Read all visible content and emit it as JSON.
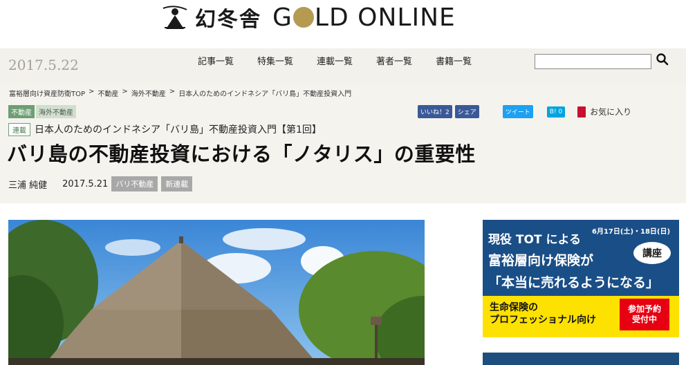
{
  "site": {
    "logo_jp": "幻冬舎",
    "logo_en_left": "G",
    "logo_en_right": "LD ONLINE"
  },
  "nav": {
    "date": "2017.5.22",
    "links": [
      "記事一覧",
      "特集一覧",
      "連載一覧",
      "著者一覧",
      "書籍一覧"
    ],
    "search_placeholder": ""
  },
  "breadcrumb": [
    "富裕層向け資産防衛TOP",
    "不動産",
    "海外不動産",
    "日本人のためのインドネシア「バリ島」不動産投資入門"
  ],
  "breadcrumb_sep": ">",
  "article": {
    "category_tags": [
      "不動産",
      "海外不動産"
    ],
    "serial_badge": "連載",
    "serial_title": "日本人のためのインドネシア「バリ島」不動産投資入門【第1回】",
    "headline": "バリ島の不動産投資における「ノタリス」の重要性",
    "author": "三浦 純健",
    "date": "2017.5.21",
    "tags": [
      "バリ不動産",
      "新連載"
    ]
  },
  "social": {
    "like_label": "いいね！2",
    "share_label": "シェア",
    "tweet_label": "ツイート",
    "hatena_label": "B! 0",
    "favorite_label": "お気に入り"
  },
  "ad": {
    "line1": "現役 TOT による",
    "dates": "6月17日(土)・18日(日)",
    "line2": "富裕層向け保険が",
    "line3": "「本当に売れるようになる」",
    "badge": "講座",
    "low_line1": "生命保険の",
    "low_line2": "プロフェッショナル向け",
    "cta": "参加予約\n受付中"
  },
  "colors": {
    "nav_bg": "#f3f1ec",
    "gold": "#b59a52",
    "green_tag": "#6e9e73",
    "ad_blue": "#1a4e86",
    "ad_yellow": "#fde100",
    "ad_red": "#e60012"
  }
}
